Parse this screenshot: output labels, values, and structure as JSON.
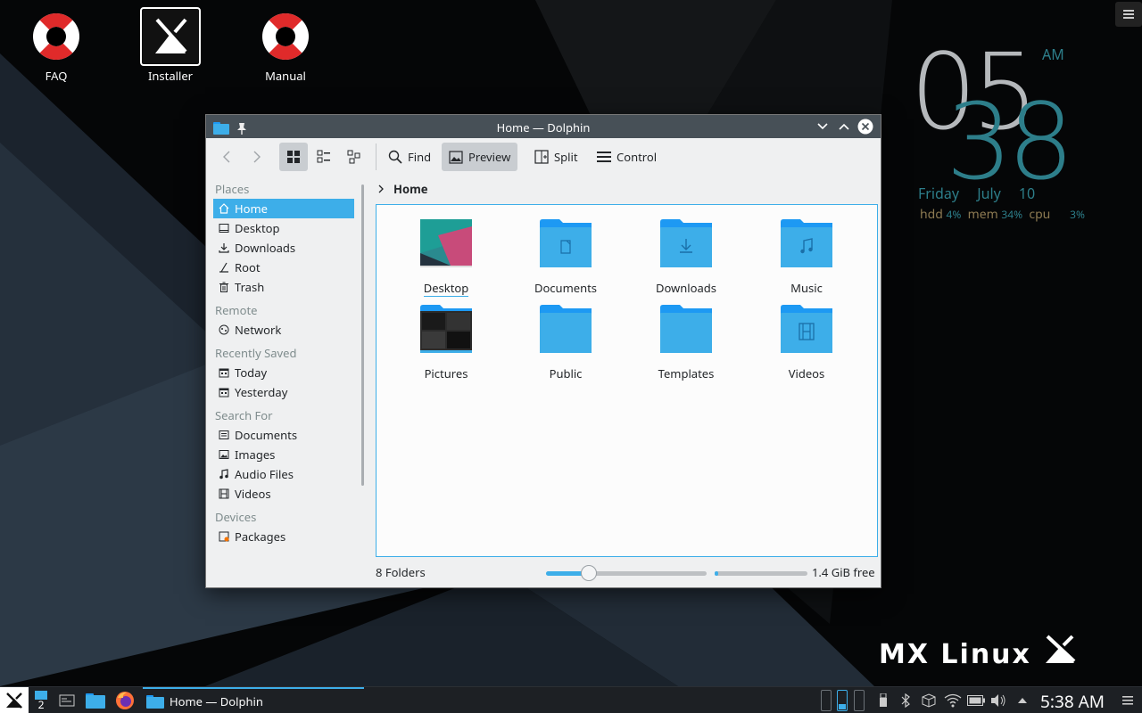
{
  "desktop": {
    "icons": [
      {
        "label": "FAQ",
        "icon": "lifebuoy-icon"
      },
      {
        "label": "Installer",
        "icon": "mx-installer-icon"
      },
      {
        "label": "Manual",
        "icon": "lifebuoy-icon"
      }
    ],
    "clock": {
      "hour": "05",
      "minute": "38",
      "ampm": "AM",
      "weekday": "Friday",
      "date": "July 10",
      "hdd_label": "hdd",
      "hdd_value": "4%",
      "mem_label": "mem",
      "mem_value": "34%",
      "cpu_label": "cpu",
      "cpu_value": "3%"
    },
    "brand": "MX Linux"
  },
  "window": {
    "title": "Home — Dolphin",
    "toolbar": {
      "find": "Find",
      "preview": "Preview",
      "split": "Split",
      "control": "Control"
    },
    "places": {
      "sections": [
        {
          "heading": "Places",
          "items": [
            {
              "label": "Home",
              "icon": "home-icon",
              "selected": true
            },
            {
              "label": "Desktop",
              "icon": "desktop-icon"
            },
            {
              "label": "Downloads",
              "icon": "download-icon"
            },
            {
              "label": "Root",
              "icon": "root-icon"
            },
            {
              "label": "Trash",
              "icon": "trash-icon"
            }
          ]
        },
        {
          "heading": "Remote",
          "items": [
            {
              "label": "Network",
              "icon": "network-icon"
            }
          ]
        },
        {
          "heading": "Recently Saved",
          "items": [
            {
              "label": "Today",
              "icon": "calendar-icon"
            },
            {
              "label": "Yesterday",
              "icon": "calendar-icon"
            }
          ]
        },
        {
          "heading": "Search For",
          "items": [
            {
              "label": "Documents",
              "icon": "document-icon"
            },
            {
              "label": "Images",
              "icon": "image-icon"
            },
            {
              "label": "Audio Files",
              "icon": "music-icon"
            },
            {
              "label": "Videos",
              "icon": "video-icon"
            }
          ]
        },
        {
          "heading": "Devices",
          "items": [
            {
              "label": "Packages",
              "icon": "drive-icon"
            }
          ]
        }
      ]
    },
    "breadcrumb": "Home",
    "files": [
      {
        "name": "Desktop",
        "icon": "desktop-thumbnail"
      },
      {
        "name": "Documents",
        "icon": "folder-documents-icon"
      },
      {
        "name": "Downloads",
        "icon": "folder-downloads-icon"
      },
      {
        "name": "Music",
        "icon": "folder-music-icon"
      },
      {
        "name": "Pictures",
        "icon": "pictures-thumbnail"
      },
      {
        "name": "Public",
        "icon": "folder-icon"
      },
      {
        "name": "Templates",
        "icon": "folder-icon"
      },
      {
        "name": "Videos",
        "icon": "folder-videos-icon"
      }
    ],
    "status": {
      "count": "8 Folders",
      "free": "1.4 GiB free",
      "disk_used_fraction": 0.04
    }
  },
  "taskbar": {
    "workspace_number": "2",
    "active_task": "Home — Dolphin",
    "time": "5:38 AM"
  },
  "colors": {
    "accent": "#3daee9",
    "titlebar": "#475057",
    "clock_teal": "#2d7e8a"
  }
}
